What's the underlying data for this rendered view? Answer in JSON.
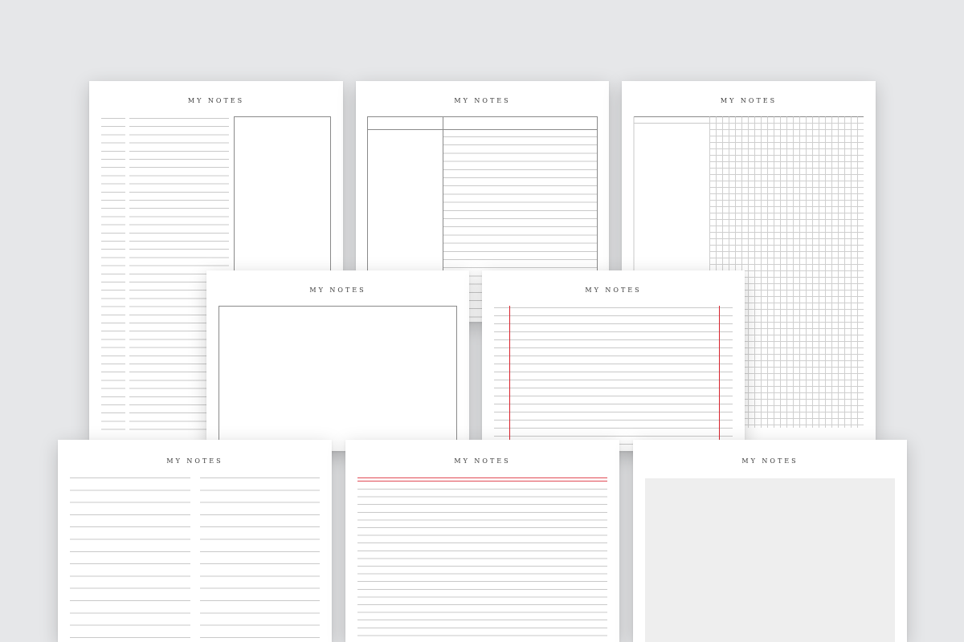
{
  "pages": [
    {
      "id": "cornell-ruled-box",
      "title": "MY NOTES"
    },
    {
      "id": "cornell-header-ruled",
      "title": "MY NOTES"
    },
    {
      "id": "cornell-grid",
      "title": "MY NOTES"
    },
    {
      "id": "blank-frame",
      "title": "MY NOTES"
    },
    {
      "id": "ruled-red-margins",
      "title": "MY NOTES"
    },
    {
      "id": "two-column-ruled",
      "title": "MY NOTES"
    },
    {
      "id": "ruled-red-top",
      "title": "MY NOTES"
    },
    {
      "id": "grey-block",
      "title": "MY NOTES"
    }
  ],
  "colors": {
    "background": "#e6e7e9",
    "paper": "#ffffff",
    "rule_line": "#c9c9c9",
    "frame_line": "#8a8a8a",
    "grid_line": "#cfcfcf",
    "margin_red": "#d9232d",
    "top_rule_red": "#e04a55",
    "fill_block": "#eeeeee",
    "title_text": "#3a3a3a"
  }
}
